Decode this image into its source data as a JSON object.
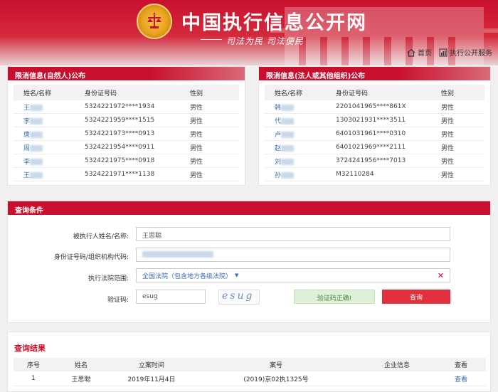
{
  "header": {
    "site_title": "中国执行信息公开网",
    "slogan": "司法为民  司法便民",
    "nav": [
      {
        "icon": "home-icon",
        "label": "首页"
      },
      {
        "icon": "bar-chart-icon",
        "label": "执行公开服务"
      }
    ]
  },
  "natural_panel": {
    "title": "限消信息(自然人)公布",
    "columns": [
      "姓名/名称",
      "身份证号码",
      "性别"
    ],
    "rows": [
      {
        "initial": "王",
        "id": "5324221972****1934",
        "gender": "男性"
      },
      {
        "initial": "李",
        "id": "5324221959****1515",
        "gender": "男性"
      },
      {
        "initial": "唐",
        "id": "5324221973****0913",
        "gender": "男性"
      },
      {
        "initial": "周",
        "id": "5324221954****0911",
        "gender": "男性"
      },
      {
        "initial": "李",
        "id": "5324221975****0918",
        "gender": "男性"
      },
      {
        "initial": "王",
        "id": "5324221971****1138",
        "gender": "男性"
      }
    ]
  },
  "legal_panel": {
    "title": "限消信息(法人或其他组织)公布",
    "columns": [
      "姓名/名称",
      "身份证号码",
      "性别"
    ],
    "rows": [
      {
        "initial": "韩",
        "id": "2201041965****861X",
        "gender": "男性"
      },
      {
        "initial": "代",
        "id": "1303021931****3511",
        "gender": "男性"
      },
      {
        "initial": "卢",
        "id": "6401031961****0310",
        "gender": "男性"
      },
      {
        "initial": "赵",
        "id": "6401021969****2111",
        "gender": "男性"
      },
      {
        "initial": "刘",
        "id": "3724241956****7013",
        "gender": "男性"
      },
      {
        "initial": "孙",
        "id": "M32110284",
        "gender": "男性"
      }
    ]
  },
  "query": {
    "title": "查询条件",
    "name_label": "被执行人姓名/名称:",
    "name_value": "王思聪",
    "id_label": "身份证号码/组织机构代码:",
    "id_value": "",
    "court_label": "执行法院范围:",
    "court_value": "全国法院（包含地方各级法院）",
    "captcha_label": "验证码:",
    "captcha_value": "esug",
    "captcha_image_text": "esug",
    "captcha_status": "验证码正确!",
    "search_button": "查询"
  },
  "results": {
    "title": "查询结果",
    "columns": [
      "序号",
      "姓名",
      "立案时间",
      "案号",
      "企业信息",
      "查看"
    ],
    "rows": [
      {
        "no": "1",
        "name": "王思聪",
        "date": "2019年11月4日",
        "case_no": "(2019)京02执1325号",
        "company": "",
        "view": "查看"
      }
    ]
  },
  "colors": {
    "brand_red": "#c8102e",
    "link_blue": "#3a6cb4",
    "success_green": "#dff0d8"
  }
}
